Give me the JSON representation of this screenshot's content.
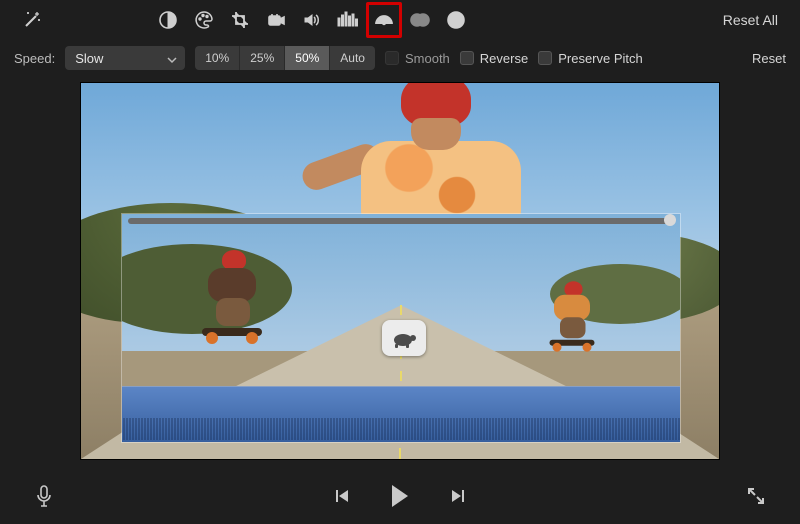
{
  "toolbar": {
    "reset_all_label": "Reset All",
    "icons": {
      "magic": "magic-wand-icon",
      "contrast": "contrast-icon",
      "palette": "palette-icon",
      "crop": "crop-icon",
      "camera": "stabilize-icon",
      "volume": "volume-icon",
      "eq": "equalizer-icon",
      "speed": "speed-gauge-icon",
      "overlap": "overlap-circles-icon",
      "info": "info-icon"
    },
    "highlighted": "speed"
  },
  "speed_row": {
    "label": "Speed:",
    "dropdown_value": "Slow",
    "segments": [
      "10%",
      "25%",
      "50%",
      "Auto"
    ],
    "active_segment": "50%",
    "smooth_label": "Smooth",
    "smooth_enabled": false,
    "reverse_label": "Reverse",
    "preserve_label": "Preserve Pitch",
    "reset_label": "Reset"
  },
  "clip": {
    "slow_badge_icon": "turtle-icon"
  },
  "transport": {
    "mic_icon": "microphone-icon",
    "prev_icon": "skip-start-icon",
    "play_icon": "play-icon",
    "next_icon": "skip-end-icon",
    "fullscreen_icon": "expand-icon"
  }
}
